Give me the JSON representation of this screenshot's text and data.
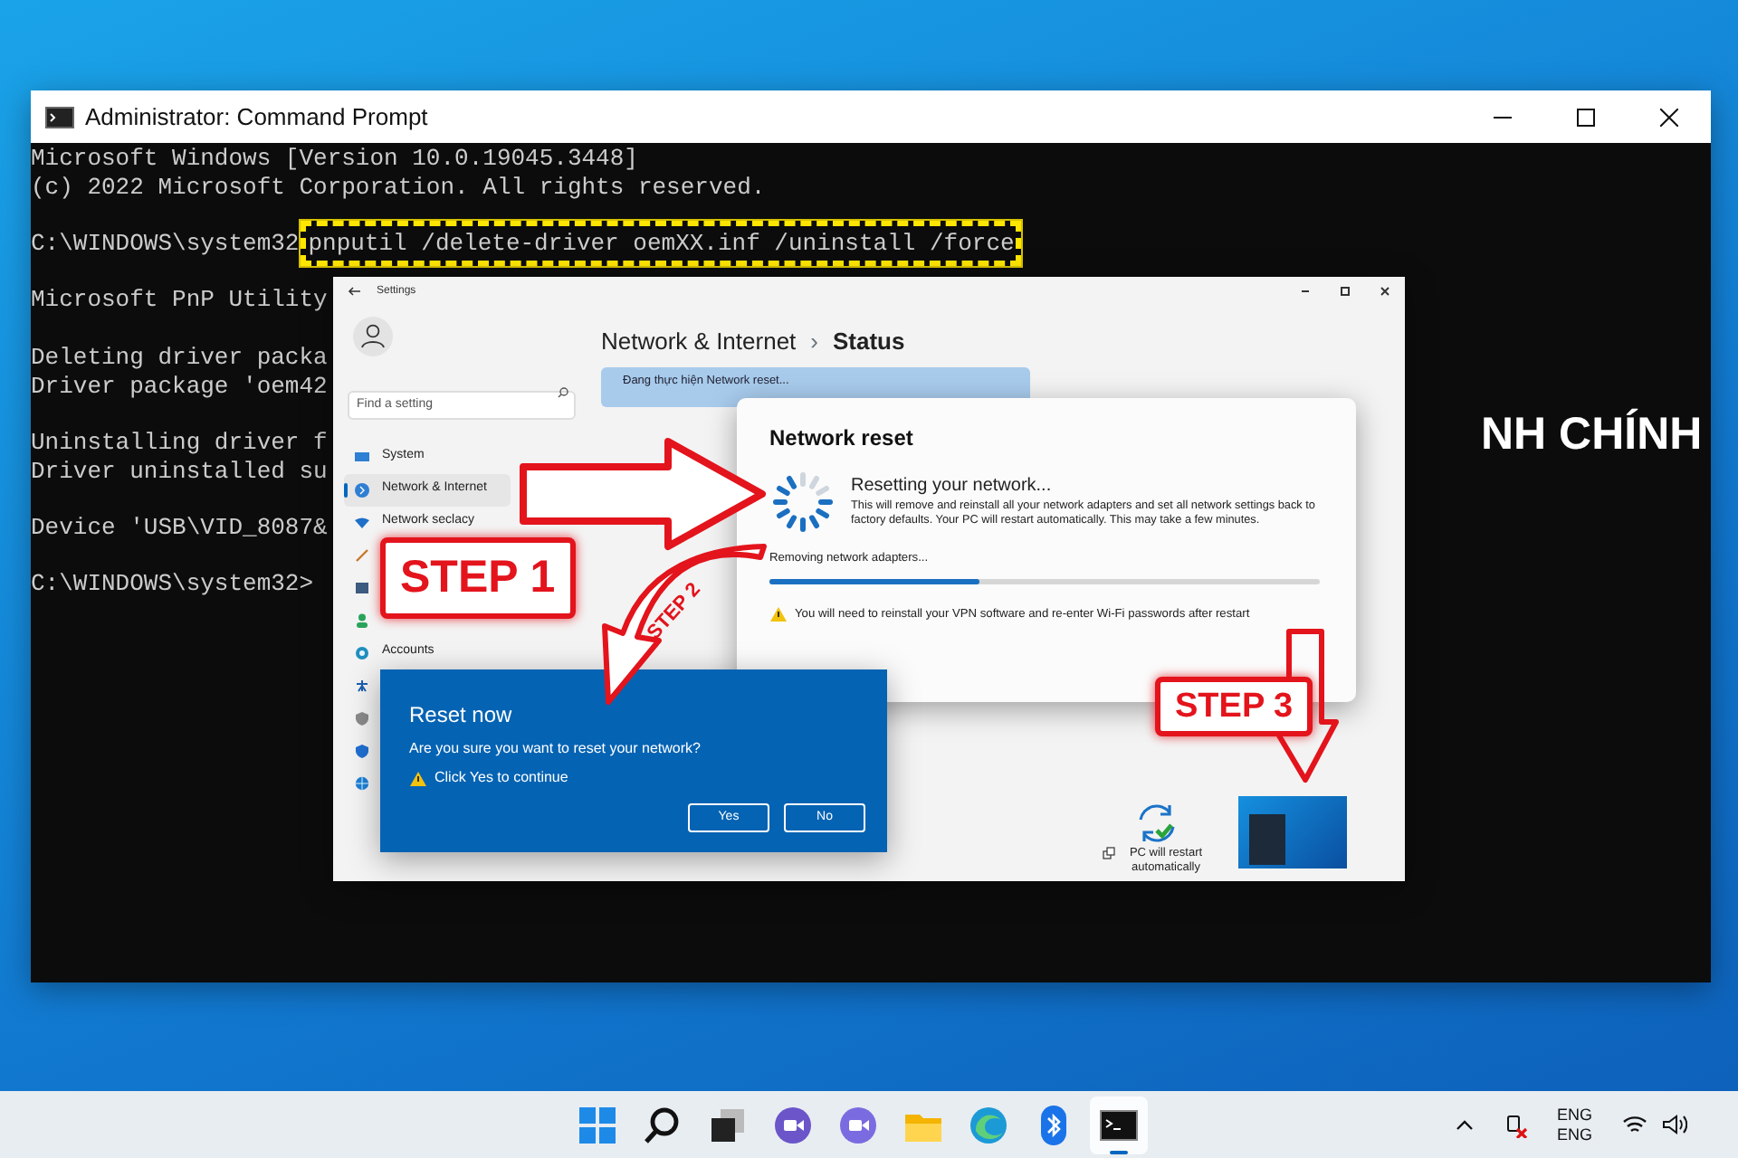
{
  "cmd_window": {
    "title": "Administrator: Command Prompt",
    "lines": [
      {
        "kind": "text",
        "text": "Microsoft Windows [Version 10.0.19045.3448]"
      },
      {
        "kind": "text",
        "text": "(c) 2022 Microsoft Corporation. All rights reserved."
      },
      {
        "kind": "blank"
      },
      {
        "kind": "command",
        "prompt": "C:\\WINDOWS\\system32",
        "command": "pnputil /delete-driver oemXX.inf /uninstall /force"
      },
      {
        "kind": "blank"
      },
      {
        "kind": "text",
        "text": "Microsoft PnP Utility"
      },
      {
        "kind": "blank"
      },
      {
        "kind": "text",
        "text": "Deleting driver packa"
      },
      {
        "kind": "text",
        "text": "Driver package 'oem42"
      },
      {
        "kind": "blank"
      },
      {
        "kind": "text",
        "text": "Uninstalling driver f"
      },
      {
        "kind": "text",
        "text": "Driver uninstalled su"
      },
      {
        "kind": "blank"
      },
      {
        "kind": "text",
        "text": "Device 'USB\\VID_8087&"
      },
      {
        "kind": "blank"
      },
      {
        "kind": "text",
        "text": "C:\\WINDOWS\\system32>"
      }
    ],
    "overlay_heading": "NH CHÍNH"
  },
  "settings_window": {
    "title": "Settings",
    "search": {
      "placeholder": "Find a setting"
    },
    "nav_items": [
      {
        "label": "System",
        "selected": false
      },
      {
        "label": "Network & Internet",
        "selected": true
      },
      {
        "label": "Network seclacy",
        "selected": false
      },
      {
        "selected": false
      },
      {
        "selected": false
      },
      {
        "selected": false
      },
      {
        "label": "Accounts",
        "selected": false
      },
      {
        "selected": false
      },
      {
        "selected": false
      },
      {
        "selected": false
      },
      {
        "selected": false
      }
    ],
    "breadcrumb": {
      "parent": "Network & Internet",
      "separator": "›",
      "current": "Status"
    },
    "banner": "Đang thực hiện Network reset...",
    "restart_note": "PC will restart automatically"
  },
  "network_reset_dialog": {
    "title": "Network reset",
    "heading": "Resetting your network...",
    "description": "This will remove and reinstall all your network adapters and set all network settings back to factory defaults. Your PC will restart automatically. This may take a few minutes.",
    "progress": {
      "label": "Removing network adapters...",
      "level": 0.38
    },
    "warning": "You will need to reinstall your VPN software and re-enter Wi-Fi passwords after restart"
  },
  "reset_now_dialog": {
    "title": "Reset now",
    "question": "Are you sure you want to reset your network?",
    "warning": "Click Yes to continue",
    "buttons": [
      "Yes",
      "No"
    ]
  },
  "annotations": [
    "STEP 1",
    "STEP 2",
    "STEP 3"
  ],
  "taskbar": {
    "apps": [
      {
        "selected": false
      },
      {
        "selected": false
      },
      {
        "selected": false
      },
      {
        "selected": false
      },
      {
        "selected": false
      },
      {
        "selected": false
      },
      {
        "selected": false
      },
      {
        "selected": false
      },
      {
        "selected": true
      }
    ],
    "language": [
      "ENG",
      "ENG"
    ]
  }
}
